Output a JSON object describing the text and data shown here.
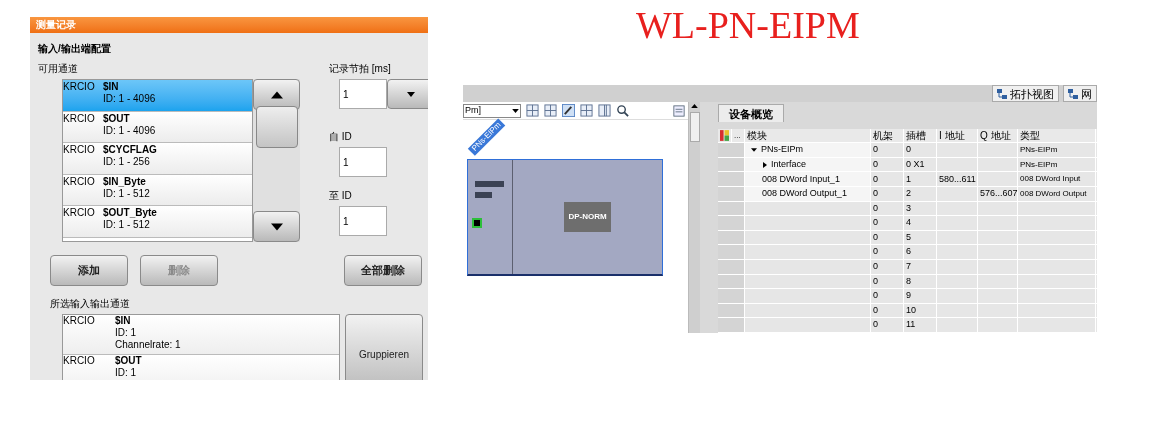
{
  "left_panel": {
    "header": "测量记录",
    "section_title": "输入/输出端配置",
    "available_label": "可用通道",
    "available_channels": [
      {
        "source": "KRCIO",
        "name": "$IN",
        "range": "ID: 1 - 4096",
        "selected": true
      },
      {
        "source": "KRCIO",
        "name": "$OUT",
        "range": "ID: 1 - 4096",
        "selected": false
      },
      {
        "source": "KRCIO",
        "name": "$CYCFLAG",
        "range": "ID: 1 - 256",
        "selected": false
      },
      {
        "source": "KRCIO",
        "name": "$IN_Byte",
        "range": "ID: 1 - 512",
        "selected": false
      },
      {
        "source": "KRCIO",
        "name": "$OUT_Byte",
        "range": "ID: 1 - 512",
        "selected": false
      }
    ],
    "rate_label": "记录节拍 [ms]",
    "rate_value": "1",
    "from_label": "自 ID",
    "from_value": "1",
    "to_label": "至 ID",
    "to_value": "1",
    "buttons": [
      {
        "label": "添加",
        "disabled": false
      },
      {
        "label": "删除",
        "disabled": true
      },
      {
        "label": "全部删除",
        "disabled": false
      }
    ],
    "selected_label": "所选输入输出通道",
    "selected_channels": [
      {
        "source": "KRCIO",
        "name": "$IN",
        "id": "ID: 1",
        "rate": "Channelrate: 1"
      },
      {
        "source": "KRCIO",
        "name": "$OUT",
        "id": "ID: 1"
      }
    ],
    "group_button": "Gruppieren"
  },
  "title": "WL-PN-EIPM",
  "right_panel": {
    "view_tabs": [
      "拓扑视图",
      "网"
    ],
    "device_dropdown": "Pm]",
    "device_tag": "PNs-EIPm",
    "module_label": "DP-NORM",
    "overview_tab": "设备概览",
    "columns": [
      "...",
      "模块",
      "机架",
      "插槽",
      "I 地址",
      "Q 地址",
      "类型"
    ],
    "rows": [
      {
        "kind": "expanded",
        "module": "PNs-EIPm",
        "rack": "0",
        "slot": "0",
        "type": "PNs-EIPm",
        "children": [
          {
            "kind": "collapsed",
            "module": "Interface",
            "rack": "0",
            "slot": "0 X1",
            "type": "PNs-EIPm"
          },
          {
            "kind": "plain",
            "module": "008 DWord Input_1",
            "rack": "0",
            "slot": "1",
            "i_address": "580...611",
            "type": "008 DWord Input"
          },
          {
            "kind": "plain",
            "module": "008 DWord Output_1",
            "rack": "0",
            "slot": "2",
            "q_address": "576...607",
            "type": "008 DWord Output"
          }
        ]
      },
      {
        "kind": "plain",
        "rack": "0",
        "slot": "3"
      },
      {
        "kind": "plain",
        "rack": "0",
        "slot": "4"
      },
      {
        "kind": "plain",
        "rack": "0",
        "slot": "5"
      },
      {
        "kind": "plain",
        "rack": "0",
        "slot": "6"
      },
      {
        "kind": "plain",
        "rack": "0",
        "slot": "7"
      },
      {
        "kind": "plain",
        "rack": "0",
        "slot": "8"
      },
      {
        "kind": "plain",
        "rack": "0",
        "slot": "9"
      },
      {
        "kind": "plain",
        "rack": "0",
        "slot": "10"
      },
      {
        "kind": "plain",
        "rack": "0",
        "slot": "11"
      }
    ]
  }
}
